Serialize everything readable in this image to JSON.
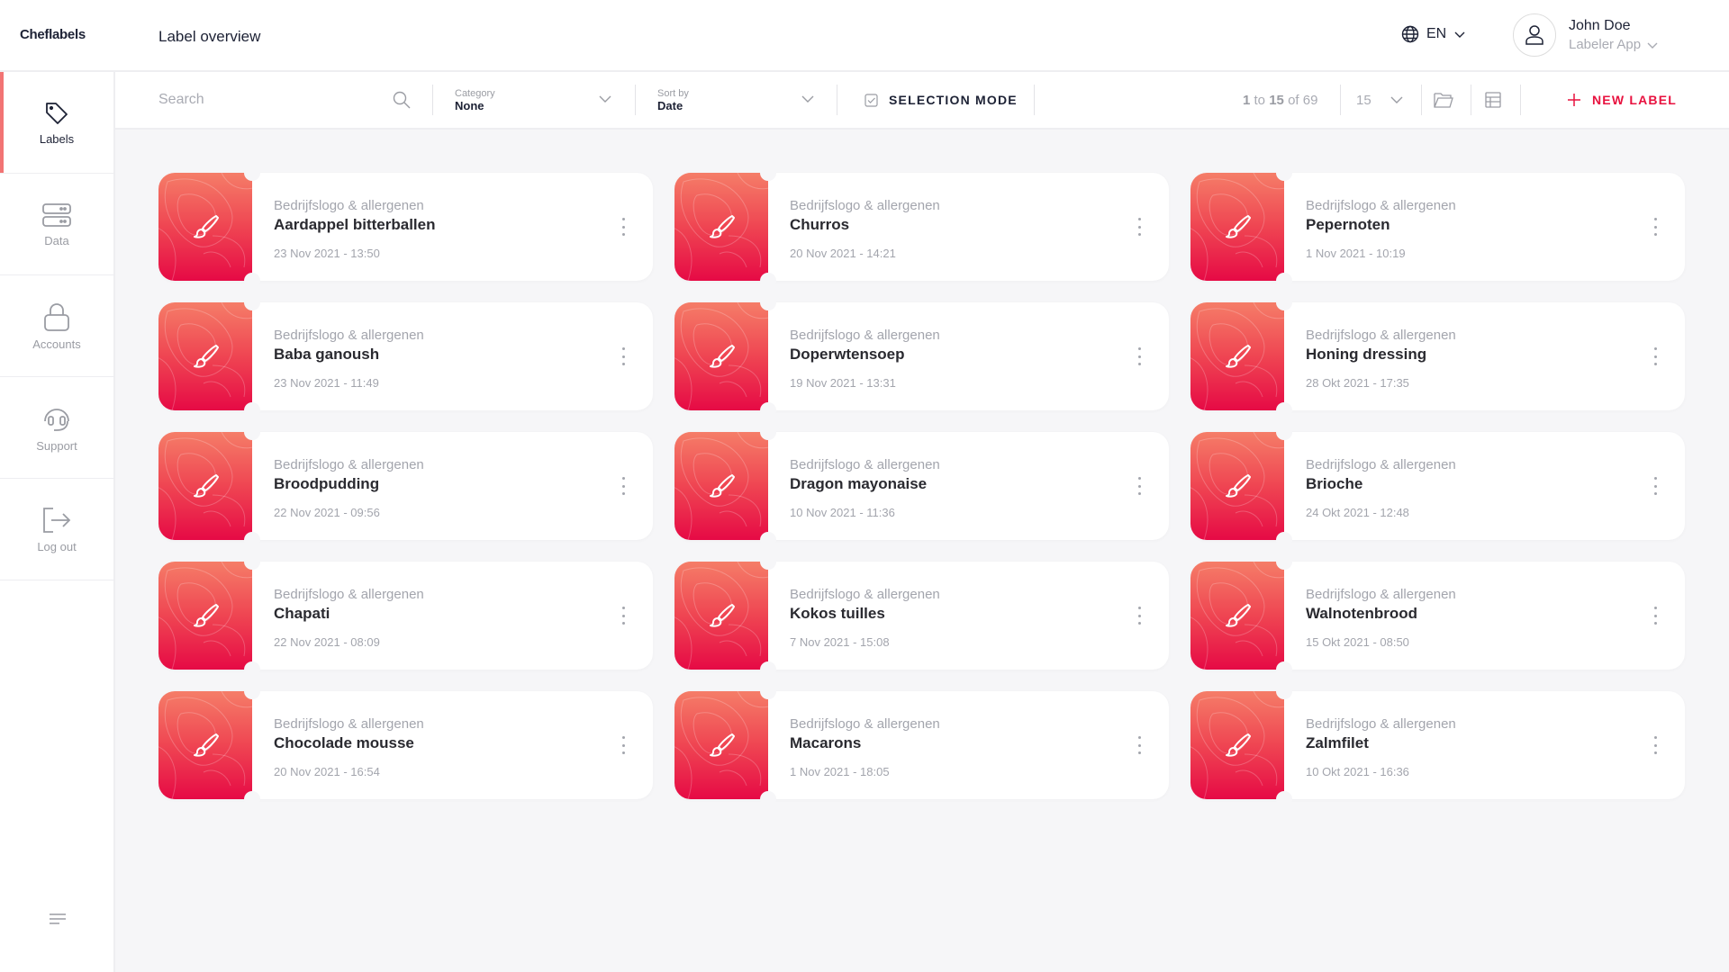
{
  "app": {
    "logo": "Cheflabels",
    "page_title": "Label overview"
  },
  "header": {
    "language": "EN",
    "user_name": "John Doe",
    "user_role": "Labeler App"
  },
  "sidebar": {
    "items": [
      {
        "label": "Labels",
        "icon": "tag-icon",
        "active": true
      },
      {
        "label": "Data",
        "icon": "server-icon"
      },
      {
        "label": "Accounts",
        "icon": "lock-icon"
      },
      {
        "label": "Support",
        "icon": "headset-icon"
      },
      {
        "label": "Log out",
        "icon": "logout-icon"
      }
    ]
  },
  "toolbar": {
    "search_placeholder": "Search",
    "category_label": "Category",
    "category_value": "None",
    "sort_label": "Sort by",
    "sort_value": "Date",
    "selection_mode": "SELECTION MODE",
    "pager_from": "1",
    "pager_to_word": "to",
    "pager_to": "15",
    "pager_of_word": "of",
    "pager_total": "69",
    "per_page": "15",
    "new_label": "NEW LABEL"
  },
  "colors": {
    "accent": "#e8123f",
    "active_indicator": "#f27474",
    "background": "#f6f6f8"
  },
  "labels": [
    {
      "category": "Bedrijfslogo & allergenen",
      "name": "Aardappel bitterballen",
      "date": "23 Nov 2021 - 13:50"
    },
    {
      "category": "Bedrijfslogo & allergenen",
      "name": "Churros",
      "date": "20 Nov 2021 - 14:21"
    },
    {
      "category": "Bedrijfslogo & allergenen",
      "name": "Pepernoten",
      "date": "1 Nov 2021 - 10:19"
    },
    {
      "category": "Bedrijfslogo & allergenen",
      "name": "Baba ganoush",
      "date": "23 Nov 2021 - 11:49"
    },
    {
      "category": "Bedrijfslogo & allergenen",
      "name": "Doperwtensoep",
      "date": "19 Nov 2021 - 13:31"
    },
    {
      "category": "Bedrijfslogo & allergenen",
      "name": "Honing dressing",
      "date": "28 Okt 2021 - 17:35"
    },
    {
      "category": "Bedrijfslogo & allergenen",
      "name": "Broodpudding",
      "date": "22 Nov 2021 - 09:56"
    },
    {
      "category": "Bedrijfslogo & allergenen",
      "name": "Dragon mayonaise",
      "date": "10 Nov 2021 - 11:36"
    },
    {
      "category": "Bedrijfslogo & allergenen",
      "name": "Brioche",
      "date": "24 Okt 2021 - 12:48"
    },
    {
      "category": "Bedrijfslogo & allergenen",
      "name": "Chapati",
      "date": "22 Nov 2021 - 08:09"
    },
    {
      "category": "Bedrijfslogo & allergenen",
      "name": "Kokos tuilles",
      "date": "7 Nov 2021 - 15:08"
    },
    {
      "category": "Bedrijfslogo & allergenen",
      "name": "Walnotenbrood",
      "date": "15 Okt 2021 - 08:50"
    },
    {
      "category": "Bedrijfslogo & allergenen",
      "name": "Chocolade mousse",
      "date": "20 Nov 2021 - 16:54"
    },
    {
      "category": "Bedrijfslogo & allergenen",
      "name": "Macarons",
      "date": "1 Nov 2021 - 18:05"
    },
    {
      "category": "Bedrijfslogo & allergenen",
      "name": "Zalmfilet",
      "date": "10 Okt 2021 - 16:36"
    }
  ]
}
